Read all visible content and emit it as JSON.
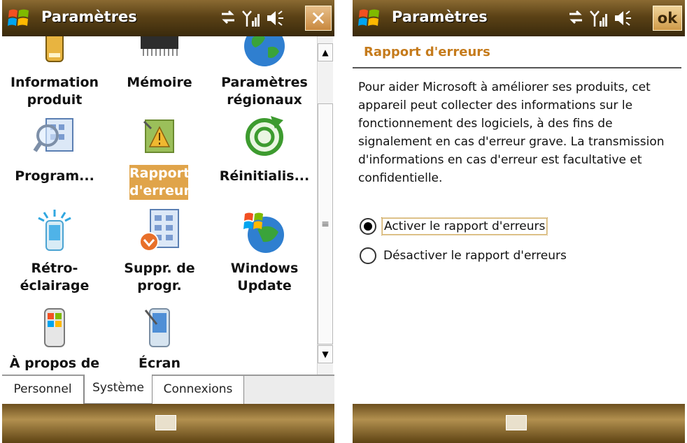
{
  "left_screen": {
    "title": "Paramètres",
    "items": [
      {
        "label": "Information produit",
        "line1": "Information",
        "line2": "produit",
        "icon": "device-info-icon"
      },
      {
        "label": "Mémoire",
        "line1": "Mémoire",
        "line2": "",
        "icon": "memory-chip-icon"
      },
      {
        "label": "Paramètres régionaux",
        "line1": "Paramètres",
        "line2": "régionaux",
        "icon": "globe-icon"
      },
      {
        "label": "Program...",
        "line1": "Program...",
        "line2": "",
        "icon": "program-manager-icon"
      },
      {
        "label": "Rapport d'erreurs",
        "line1": "Rapport",
        "line2": "d'erreurs",
        "icon": "error-report-icon",
        "selected": true
      },
      {
        "label": "Réinitialis...",
        "line1": "Réinitialis...",
        "line2": "",
        "icon": "reset-icon"
      },
      {
        "label": "Rétro-éclairage",
        "line1": "Rétro-",
        "line2": "éclairage",
        "icon": "backlight-icon"
      },
      {
        "label": "Suppr. de progr.",
        "line1": "Suppr. de",
        "line2": "progr.",
        "icon": "remove-programs-icon"
      },
      {
        "label": "Windows Update",
        "line1": "Windows",
        "line2": "Update",
        "icon": "windows-update-icon"
      },
      {
        "label": "À propos de",
        "line1": "À propos de",
        "line2": "",
        "icon": "about-icon"
      },
      {
        "label": "Écran",
        "line1": "Écran",
        "line2": "",
        "icon": "screen-icon"
      }
    ],
    "tabs": [
      "Personnel",
      "Système",
      "Connexions"
    ],
    "active_tab": "Système",
    "close_label": "✕"
  },
  "right_screen": {
    "title": "Paramètres",
    "ok_label": "ok",
    "section_title": "Rapport d'erreurs",
    "description": "Pour aider Microsoft à améliorer ses produits, cet appareil peut collecter des informations sur le fonctionnement des logiciels, à des fins de signalement en cas d'erreur grave. La transmission d'informations en cas d'erreur est facultative et confidentielle.",
    "options": [
      {
        "label": "Activer le rapport d'erreurs",
        "checked": true
      },
      {
        "label": "Désactiver le rapport d'erreurs",
        "checked": false
      }
    ]
  },
  "colors": {
    "accent": "#e0a44a",
    "section_title": "#c57b1c",
    "titlebar_dark": "#3a2a0c"
  }
}
